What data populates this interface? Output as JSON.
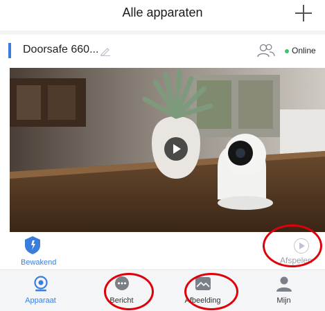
{
  "header": {
    "title": "Alle apparaten",
    "add_icon": "plus-icon"
  },
  "device": {
    "name": "Doorsafe 660...",
    "status": "Online",
    "status_color": "#3ec46d",
    "accent_color": "#3b7ddd",
    "edit_icon": "pencil-icon",
    "share_icon": "users-icon",
    "preview_icon": "play-icon"
  },
  "controls": {
    "guard_label": "Bewakend",
    "guard_icon": "shield-icon",
    "play_label": "Afspelen",
    "play_icon": "play-circle-icon"
  },
  "tabs": [
    {
      "label": "Apparaat",
      "icon": "camera-icon",
      "active": true
    },
    {
      "label": "Bericht",
      "icon": "chat-bubble-icon",
      "active": false
    },
    {
      "label": "Afbeelding",
      "icon": "image-icon",
      "active": false
    },
    {
      "label": "Mijn",
      "icon": "person-icon",
      "active": false
    }
  ],
  "colors": {
    "active": "#3b7ddd",
    "highlight_circle": "#e0000a"
  }
}
